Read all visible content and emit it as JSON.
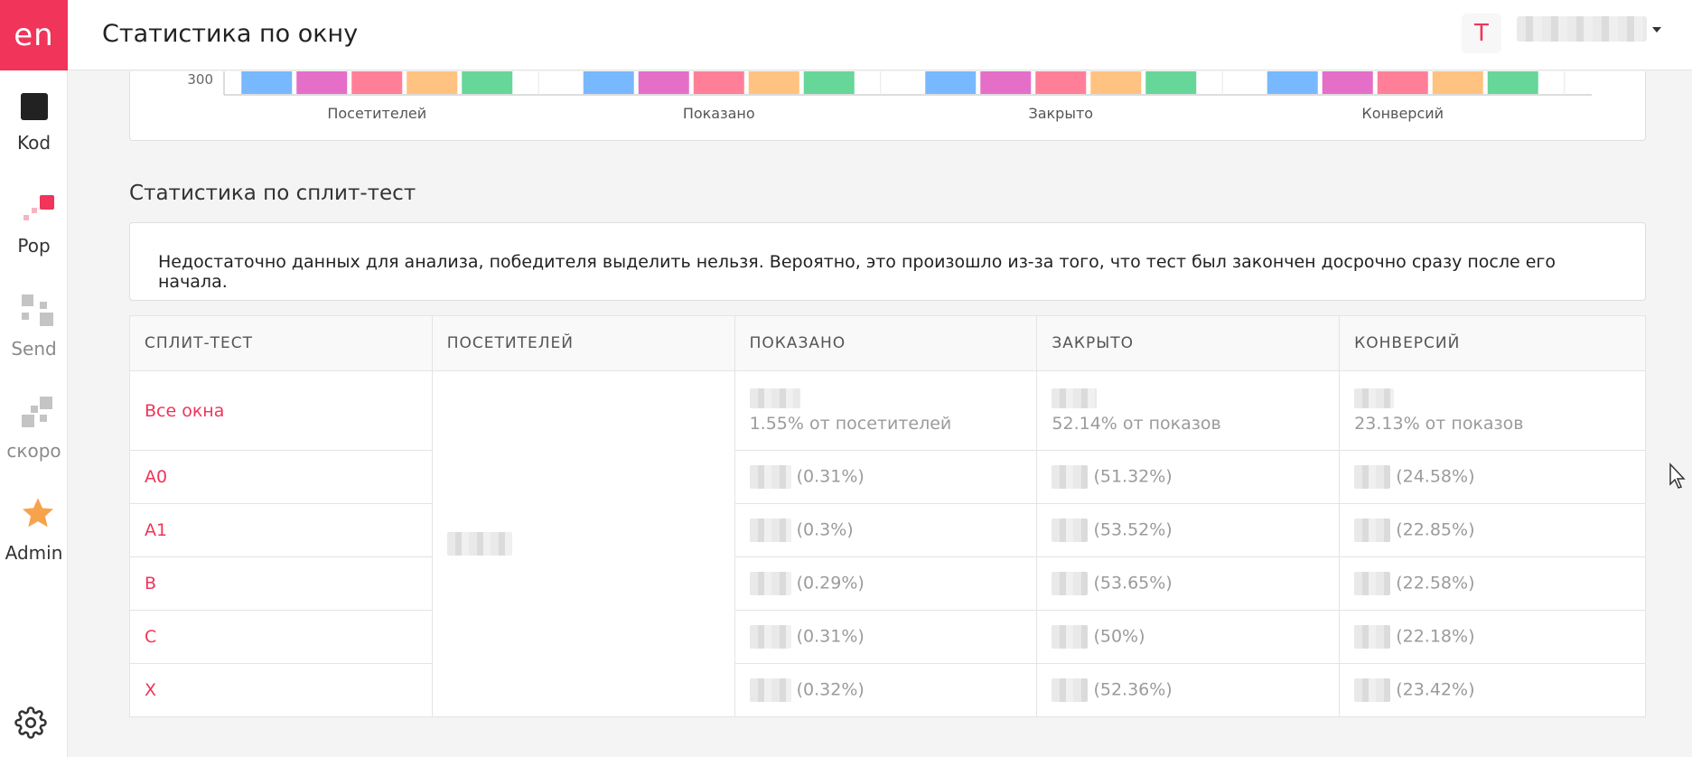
{
  "app": {
    "logo": "en"
  },
  "sidebar": {
    "items": [
      {
        "label": "Kod"
      },
      {
        "label": "Pop"
      },
      {
        "label": "Send"
      },
      {
        "label": "скоро"
      },
      {
        "label": "Admin"
      }
    ],
    "accent": "#f0345a",
    "star_color": "#f7a34b"
  },
  "header": {
    "title": "Статистика по окну",
    "avatar_letter": "T"
  },
  "chart": {
    "tick": "300",
    "groups": [
      "Посетителей",
      "Показано",
      "Закрыто",
      "Конверсий"
    ],
    "bar_colors": [
      "#78b8ff",
      "#e56ec9",
      "#ff7f99",
      "#ffc280",
      "#66d699"
    ]
  },
  "split": {
    "section_title": "Статистика по сплит-тест",
    "notice": "Недостаточно данных для анализа, победителя выделить нельзя. Вероятно, это произошло из-за того, что тест был закончен досрочно сразу после его начала.",
    "columns": [
      "СПЛИТ-ТЕСТ",
      "ПОСЕТИТЕЛЕЙ",
      "ПОКАЗАНО",
      "ЗАКРЫТО",
      "КОНВЕРСИЙ"
    ],
    "all_row": {
      "name": "Все окна",
      "shown_sub": "1.55% от посетителей",
      "closed_sub": "52.14% от показов",
      "conv_sub": "23.13% от показов"
    },
    "rows": [
      {
        "name": "A0",
        "shown": "(0.31%)",
        "closed": "(51.32%)",
        "conv": "(24.58%)"
      },
      {
        "name": "A1",
        "shown": "(0.3%)",
        "closed": "(53.52%)",
        "conv": "(22.85%)"
      },
      {
        "name": "B",
        "shown": "(0.29%)",
        "closed": "(53.65%)",
        "conv": "(22.58%)"
      },
      {
        "name": "C",
        "shown": "(0.31%)",
        "closed": "(50%)",
        "conv": "(22.18%)"
      },
      {
        "name": "X",
        "shown": "(0.32%)",
        "closed": "(52.36%)",
        "conv": "(23.42%)"
      }
    ]
  }
}
